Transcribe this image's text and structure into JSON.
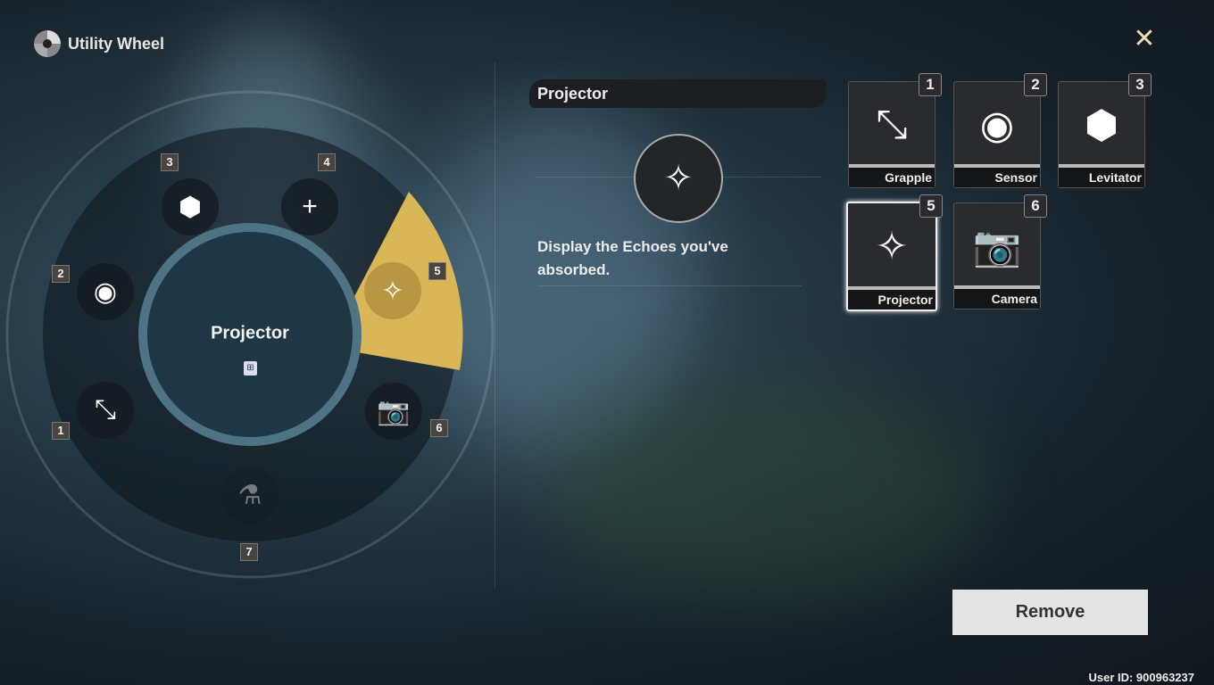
{
  "header": {
    "title": "Utility Wheel",
    "logo_icon": "utility-wheel-logo",
    "close_icon": "close-x-icon"
  },
  "wheel": {
    "selected_name": "Projector",
    "selected_key_icon": "keybind-icon",
    "accent_color": "#d9b756",
    "slots": [
      {
        "number": "1",
        "name": "Grapple",
        "icon": "grapple-icon",
        "glyph": "⤡"
      },
      {
        "number": "2",
        "name": "Sensor",
        "icon": "sensor-eye-icon",
        "glyph": "◉"
      },
      {
        "number": "3",
        "name": "Levitator",
        "icon": "cube-icon",
        "glyph": "⬢"
      },
      {
        "number": "4",
        "name": "",
        "icon": "plus-icon",
        "glyph": "+"
      },
      {
        "number": "5",
        "name": "Projector",
        "icon": "projector-icon",
        "glyph": "✧"
      },
      {
        "number": "6",
        "name": "Camera",
        "icon": "camera-icon",
        "glyph": "📷"
      },
      {
        "number": "7",
        "name": "",
        "icon": "potion-plus-icon",
        "glyph": "⚗"
      }
    ]
  },
  "detail": {
    "title": "Projector",
    "icon": "projector-icon",
    "glyph": "✧",
    "description": "Display the Echoes you've absorbed."
  },
  "tools": [
    {
      "number": "1",
      "label": "Grapple",
      "icon": "grapple-icon",
      "glyph": "⤡"
    },
    {
      "number": "2",
      "label": "Sensor",
      "icon": "sensor-eye-icon",
      "glyph": "◉"
    },
    {
      "number": "3",
      "label": "Levitator",
      "icon": "cube-icon",
      "glyph": "⬢"
    },
    {
      "number": "5",
      "label": "Projector",
      "icon": "projector-icon",
      "glyph": "✧",
      "selected": true
    },
    {
      "number": "6",
      "label": "Camera",
      "icon": "camera-icon",
      "glyph": "📷"
    }
  ],
  "actions": {
    "remove_label": "Remove"
  },
  "footer": {
    "user_id": "User ID: 900963237"
  }
}
